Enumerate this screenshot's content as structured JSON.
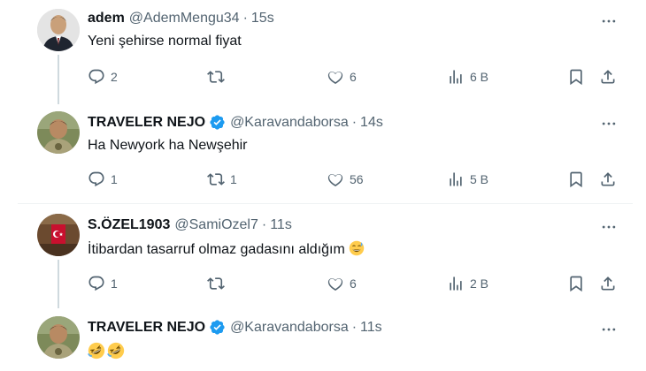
{
  "tweets": [
    {
      "name": "adem",
      "handle": "@AdemMengu34",
      "separator": "·",
      "time": "15s",
      "text": "Yeni şehirse normal fiyat",
      "verified": false,
      "replies": "2",
      "retweets": "",
      "likes": "6",
      "views": "6 B"
    },
    {
      "name": "TRAVELER NEJO",
      "handle": "@Karavandaborsa",
      "separator": "·",
      "time": "14s",
      "text": "Ha Newyork ha Newşehir",
      "verified": true,
      "replies": "1",
      "retweets": "1",
      "likes": "56",
      "views": "5 B"
    },
    {
      "name": "S.ÖZEL1903",
      "handle": "@SamiOzel7",
      "separator": "·",
      "time": "11s",
      "text": "İtibardan tasarruf olmaz gadasını aldığım",
      "verified": false,
      "replies": "1",
      "retweets": "",
      "likes": "6",
      "views": "2 B"
    },
    {
      "name": "TRAVELER NEJO",
      "handle": "@Karavandaborsa",
      "separator": "·",
      "time": "11s",
      "text": "",
      "verified": true
    }
  ],
  "colors": {
    "text": "#0f1419",
    "secondary": "#536471",
    "verified": "#1d9bf0",
    "thread_line": "#cfd9de",
    "divider": "#eff3f4"
  },
  "icons": [
    "reply-icon",
    "retweet-icon",
    "like-icon",
    "views-icon",
    "bookmark-icon",
    "share-icon",
    "more-icon",
    "verified-icon",
    "sweat-smile-emoji",
    "rofl-emoji"
  ]
}
